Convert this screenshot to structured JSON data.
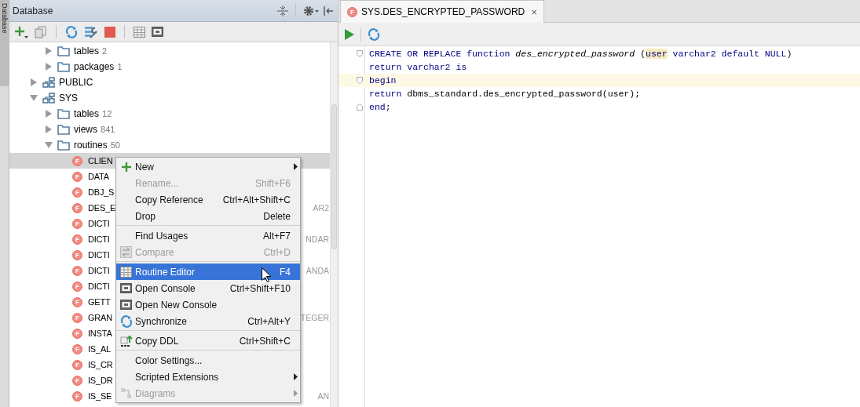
{
  "side_tab": {
    "label": "Database"
  },
  "db_panel": {
    "title": "Database",
    "tree": [
      {
        "kind": "offscreen-schema",
        "children": [
          {
            "label": "tables",
            "count": "2",
            "kind": "folder",
            "expanded": false,
            "selected": false
          },
          {
            "label": "packages",
            "count": "1",
            "kind": "folder",
            "expanded": false,
            "selected": false
          }
        ]
      },
      {
        "label": "PUBLIC",
        "kind": "schema",
        "expanded": false,
        "selected": false
      },
      {
        "label": "SYS",
        "kind": "schema",
        "expanded": true,
        "selected": false,
        "children": [
          {
            "label": "tables",
            "count": "12",
            "kind": "folder",
            "expanded": false,
            "selected": false
          },
          {
            "label": "views",
            "count": "841",
            "kind": "folder",
            "expanded": false,
            "selected": false
          },
          {
            "label": "routines",
            "count": "50",
            "kind": "folder",
            "expanded": true,
            "selected": false,
            "children": [
              {
                "label": "CLIEN",
                "kind": "function",
                "badge": "F",
                "selected": true
              },
              {
                "label": "DATA",
                "kind": "function",
                "badge": "F",
                "selected": false
              },
              {
                "label": "DBJ_S",
                "kind": "function",
                "badge": "F",
                "selected": false
              },
              {
                "label": "DES_E",
                "kind": "function",
                "badge": "F",
                "selected": false,
                "tail": "AR2"
              },
              {
                "label": "DICTI",
                "kind": "function",
                "badge": "F",
                "selected": false
              },
              {
                "label": "DICTI",
                "kind": "function",
                "badge": "F",
                "selected": false,
                "tail": "NDAR"
              },
              {
                "label": "DICTI",
                "kind": "function",
                "badge": "F",
                "selected": false
              },
              {
                "label": "DICTI",
                "kind": "function",
                "badge": "F",
                "selected": false,
                "tail": "ANDA"
              },
              {
                "label": "DICTI",
                "kind": "function",
                "badge": "F",
                "selected": false
              },
              {
                "label": "GETT",
                "kind": "function",
                "badge": "F",
                "selected": false
              },
              {
                "label": "GRAN",
                "kind": "function",
                "badge": "F",
                "selected": false,
                "tail": "TEGER"
              },
              {
                "label": "INSTA",
                "kind": "function",
                "badge": "F",
                "selected": false
              },
              {
                "label": "IS_AL",
                "kind": "function",
                "badge": "F",
                "selected": false
              },
              {
                "label": "IS_CR",
                "kind": "function",
                "badge": "F",
                "selected": false
              },
              {
                "label": "IS_DR",
                "kind": "function",
                "badge": "F",
                "selected": false
              },
              {
                "label": "IS_SE",
                "kind": "function",
                "badge": "F",
                "selected": false,
                "tail": "AN"
              }
            ]
          }
        ]
      }
    ]
  },
  "context_menu": {
    "items": [
      {
        "kind": "item",
        "label": "New",
        "submenu": true,
        "disabled": false,
        "selected": false
      },
      {
        "kind": "item",
        "label": "Rename...",
        "shortcut": "Shift+F6",
        "submenu": false,
        "disabled": true,
        "selected": false
      },
      {
        "kind": "item",
        "label": "Copy Reference",
        "shortcut": "Ctrl+Alt+Shift+C",
        "submenu": false,
        "disabled": false,
        "selected": false
      },
      {
        "kind": "item",
        "label": "Drop",
        "shortcut": "Delete",
        "submenu": false,
        "disabled": false,
        "selected": false
      },
      {
        "kind": "separator"
      },
      {
        "kind": "item",
        "label": "Find Usages",
        "shortcut": "Alt+F7",
        "submenu": false,
        "disabled": false,
        "selected": false
      },
      {
        "kind": "item",
        "label": "Compare",
        "shortcut": "Ctrl+D",
        "submenu": false,
        "disabled": true,
        "selected": false
      },
      {
        "kind": "separator"
      },
      {
        "kind": "item",
        "label": "Routine Editor",
        "shortcut": "F4",
        "submenu": false,
        "disabled": false,
        "selected": true
      },
      {
        "kind": "item",
        "label": "Open Console",
        "shortcut": "Ctrl+Shift+F10",
        "submenu": false,
        "disabled": false,
        "selected": false
      },
      {
        "kind": "item",
        "label": "Open New Console",
        "submenu": false,
        "disabled": false,
        "selected": false
      },
      {
        "kind": "item",
        "label": "Synchronize",
        "shortcut": "Ctrl+Alt+Y",
        "submenu": false,
        "disabled": false,
        "selected": false
      },
      {
        "kind": "separator"
      },
      {
        "kind": "item",
        "label": "Copy DDL",
        "shortcut": "Ctrl+Shift+C",
        "submenu": false,
        "disabled": false,
        "selected": false
      },
      {
        "kind": "separator"
      },
      {
        "kind": "item",
        "label": "Color Settings...",
        "submenu": false,
        "disabled": false,
        "selected": false
      },
      {
        "kind": "item",
        "label": "Scripted Extensions",
        "submenu": true,
        "disabled": false,
        "selected": false
      },
      {
        "kind": "item",
        "label": "Diagrams",
        "submenu": true,
        "disabled": true,
        "selected": false
      }
    ]
  },
  "editor": {
    "tabs": [
      {
        "label": "SYS.DES_ENCRYPTED_PASSWORD",
        "badge": "F",
        "close": "×",
        "selected": true
      }
    ],
    "lines": [
      {
        "current": false,
        "fold_start": true,
        "fold_end": false,
        "segments": [
          {
            "kind": "keyword",
            "text": "CREATE OR REPLACE function "
          },
          {
            "kind": "name",
            "text": "des_encrypted_password"
          },
          {
            "kind": "plain",
            "text": " ("
          },
          {
            "kind": "usage",
            "text": "user"
          },
          {
            "kind": "keyword",
            "text": " varchar2 default NULL"
          },
          {
            "kind": "plain",
            "text": ")"
          }
        ]
      },
      {
        "current": false,
        "fold_start": false,
        "fold_end": false,
        "segments": [
          {
            "kind": "keyword",
            "text": "return varchar2 is"
          }
        ]
      },
      {
        "current": true,
        "fold_start": true,
        "fold_end": false,
        "segments": [
          {
            "kind": "keyword",
            "text": "begin"
          }
        ]
      },
      {
        "current": false,
        "fold_start": false,
        "fold_end": false,
        "segments": [
          {
            "kind": "keyword",
            "text": "return "
          },
          {
            "kind": "plain",
            "text": "dbms_standard.des_encrypted_password(user);"
          }
        ]
      },
      {
        "current": false,
        "fold_start": false,
        "fold_end": true,
        "segments": [
          {
            "kind": "keyword",
            "text": "end"
          },
          {
            "kind": "plain",
            "text": ";"
          }
        ]
      }
    ]
  }
}
